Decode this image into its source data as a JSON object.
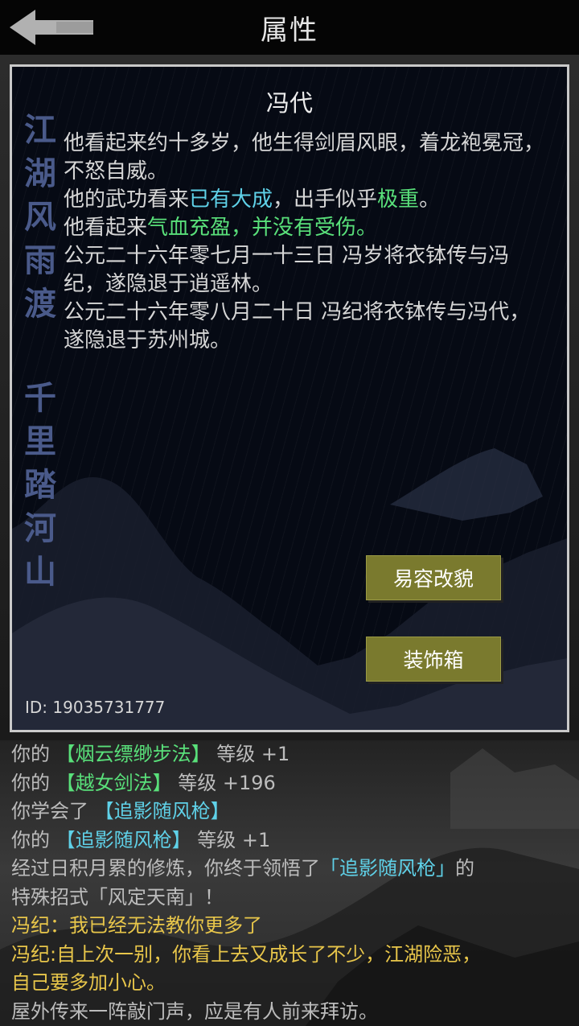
{
  "header": {
    "title": "属性",
    "back_icon": "arrow-left-icon"
  },
  "character": {
    "name": "冯代",
    "calligraphy_top": [
      "江",
      "湖",
      "风",
      "雨",
      "渡"
    ],
    "calligraphy_bottom": [
      "千",
      "里",
      "踏",
      "河",
      "山"
    ],
    "desc": {
      "line1": "他看起来约十多岁，他生得剑眉风眼，着龙袍冕冠，不怒自威。",
      "line2a": "他的武功看来",
      "line2b": "已有大成",
      "line2c": "，出手似乎",
      "line2d": "极重",
      "line2e": "。",
      "line3a": "他看起来",
      "line3b": "气血充盈，并没有受伤。",
      "line4": "公元二十六年零七月一十三日 冯岁将衣钵传与冯纪，遂隐退于逍遥林。",
      "line5": "公元二十六年零八月二十日 冯纪将衣钵传与冯代，遂隐退于苏州城。"
    },
    "buttons": {
      "disguise": "易容改貌",
      "decor": "装饰箱"
    },
    "id_text": "ID: 19035731777"
  },
  "log": {
    "l1a": "你的 ",
    "l1b": "【烟云缥缈步法】",
    "l1c": " 等级 +1",
    "l2a": "你的 ",
    "l2b": "【越女剑法】",
    "l2c": " 等级 +196",
    "l3a": "你学会了 ",
    "l3b": "【追影随风枪】",
    "l4a": "你的 ",
    "l4b": "【追影随风枪】",
    "l4c": " 等级 +1",
    "l5a": "经过日积月累的修炼，你终于领悟了",
    "l5b": "「追影随风枪」",
    "l5c": "的",
    "l6": "特殊招式「风定天南」！",
    "l7": "冯纪：我已经无法教你更多了",
    "l8": "冯纪:自上次一别，你看上去又成长了不少，江湖险恶，",
    "l9": "自己要多加小心。",
    "l10": "屋外传来一阵敲门声，应是有人前来拜访。"
  },
  "colors": {
    "button_bg": "#7a7a2e",
    "highlight_blue": "#5fd1e8",
    "highlight_green": "#59e07a",
    "npc_yellow": "#e8c64a"
  }
}
